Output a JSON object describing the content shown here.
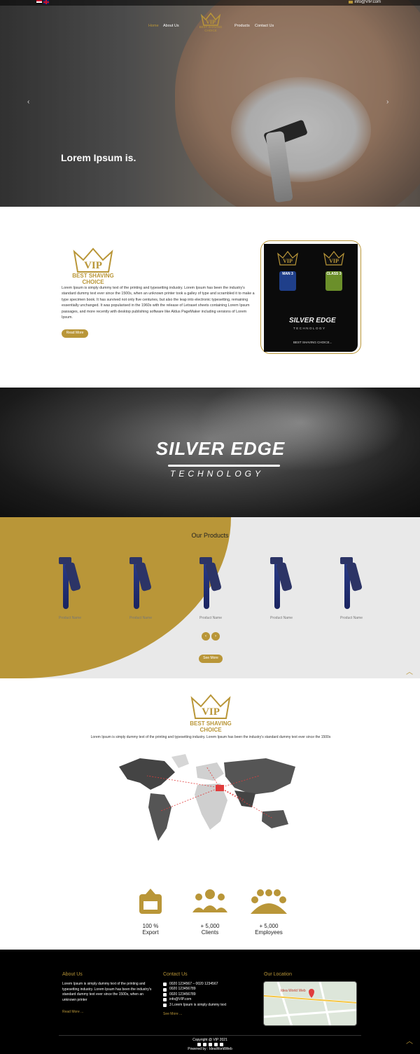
{
  "topbar": {
    "email": "info@VIP.com"
  },
  "nav": {
    "home": "Home",
    "about": "About Us",
    "products": "Products",
    "contact": "Contact Us",
    "logo_text": "VIP",
    "logo_tag": "BEST SHAVING CHOICE"
  },
  "hero": {
    "title": "Lorem Ipsum is.",
    "prev": "‹",
    "next": "›"
  },
  "about": {
    "logo_text": "VIP",
    "tag": "BEST SHAVING CHOICE",
    "body": "Lorem Ipsum is simply dummy text of the printing and typesetting industry. Lorem Ipsum has been the industry's standard dummy text ever since the 1500s, when an unknown printer took a galley of type and scrambled it to make a type specimen book. It has survived not only five centuries, but also the leap into electronic typesetting, remaining essentially unchanged. It was popularised in the 1960s with the release of Letraset sheets containing Lorem Ipsum passages, and more recently with desktop publishing software like Aldus PageMaker including versions of Lorem Ipsum.",
    "button": "Read More",
    "card": {
      "pack1": "VIP",
      "pack1_sub": "MAN 3",
      "pack2": "VIP",
      "pack2_sub": "CLASS 3",
      "title": "SILVER EDGE",
      "subtitle": "TECHNOLOGY",
      "tagline": "BEST SHAVING CHOICE..."
    }
  },
  "silver": {
    "title": "SILVER EDGE",
    "subtitle": "TECHNOLOGY"
  },
  "products": {
    "heading": "Our Products",
    "items": [
      "Product Name",
      "Product Name",
      "Product Name",
      "Product Name",
      "Product Name"
    ],
    "prev": "‹",
    "next": "›",
    "button": "See More"
  },
  "world": {
    "logo_text": "VIP",
    "tag": "BEST SHAVING CHOICE",
    "body": "Lorem Ipsum is simply dummy text of the printing and typesetting industry. Lorem Ipsum has been the industry's standard dummy text ever since the 1500s"
  },
  "stats": [
    {
      "value": "100 %",
      "label": "Export"
    },
    {
      "value": "+ 5,000",
      "label": "Clients"
    },
    {
      "value": "+ 5,000",
      "label": "Employees"
    }
  ],
  "footer": {
    "about_title": "About Us",
    "about_body": "Lorem Ipsum is simply dummy text of the printing and typesetting industry. Lorem Ipsum has been the industry's standard dummy text ever since the 1500s, when an unknown printer",
    "about_more": "Read More ...",
    "contact_title": "Contact Us",
    "phone": "0020 1234567 – 0020 1234567",
    "mobile": "0020 123456789",
    "whatsapp": "0020 123456789",
    "email": "info@VIP.com",
    "address": "3 Lorem Ipsum is simply dummy text",
    "contact_more": "See More ...",
    "location_title": "Our Location",
    "map_label": "Idea World Web",
    "copyright": "Copyright @ VIP 2021",
    "powered": "Powered by : IdeaWorldWeb"
  },
  "colors": {
    "accent": "#b99638",
    "footer_bg": "#000000",
    "products_bg": "#e9e9e9"
  }
}
